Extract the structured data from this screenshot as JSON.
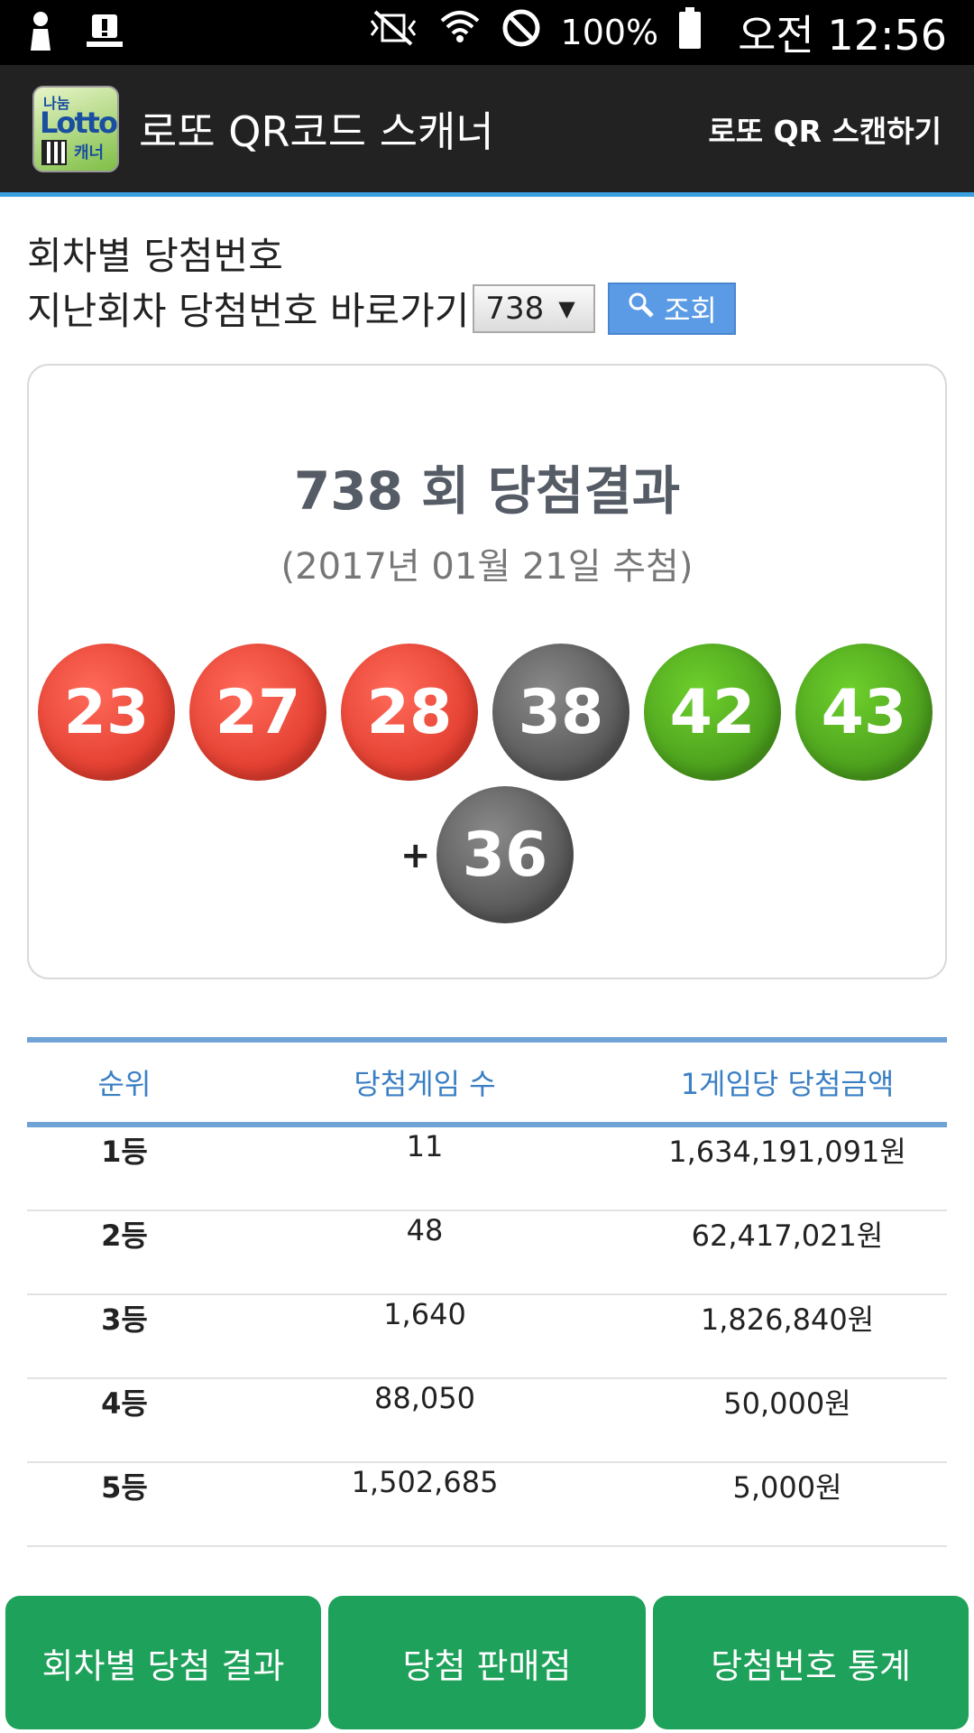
{
  "status_bar": {
    "battery": "100%",
    "time": "오전 12:56"
  },
  "app_bar": {
    "title": "로또 QR코드 스캐너",
    "action": "로또 QR 스캔하기",
    "logo_top": "나눔",
    "logo_main": "Lotto",
    "logo_sub": "캐너"
  },
  "header": {
    "section_title": "회차별 당첨번호",
    "jump_label": "지난회차 당첨번호 바로가기",
    "selected_round": "738",
    "search_label": "조회"
  },
  "result": {
    "title": "738 회 당첨결과",
    "date": "(2017년 01월 21일 추첨)",
    "numbers": [
      "23",
      "27",
      "28",
      "38",
      "42",
      "43"
    ],
    "plus": "+",
    "bonus": "36"
  },
  "prize_table": {
    "headers": [
      "순위",
      "당첨게임 수",
      "1게임당 당첨금액"
    ],
    "rows": [
      [
        "1등",
        "11",
        "1,634,191,091원"
      ],
      [
        "2등",
        "48",
        "62,417,021원"
      ],
      [
        "3등",
        "1,640",
        "1,826,840원"
      ],
      [
        "4등",
        "88,050",
        "50,000원"
      ],
      [
        "5등",
        "1,502,685",
        "5,000원"
      ]
    ]
  },
  "bottom_nav": {
    "items": [
      "회차별 당첨 결과",
      "당첨 판매점",
      "당첨번호 통계"
    ]
  },
  "colors": {
    "accent": "#3aa0e0",
    "nav_green": "#1ea15a",
    "ball_red": "#e23d2e",
    "ball_gray": "#555555",
    "ball_green": "#4a9d1c"
  }
}
